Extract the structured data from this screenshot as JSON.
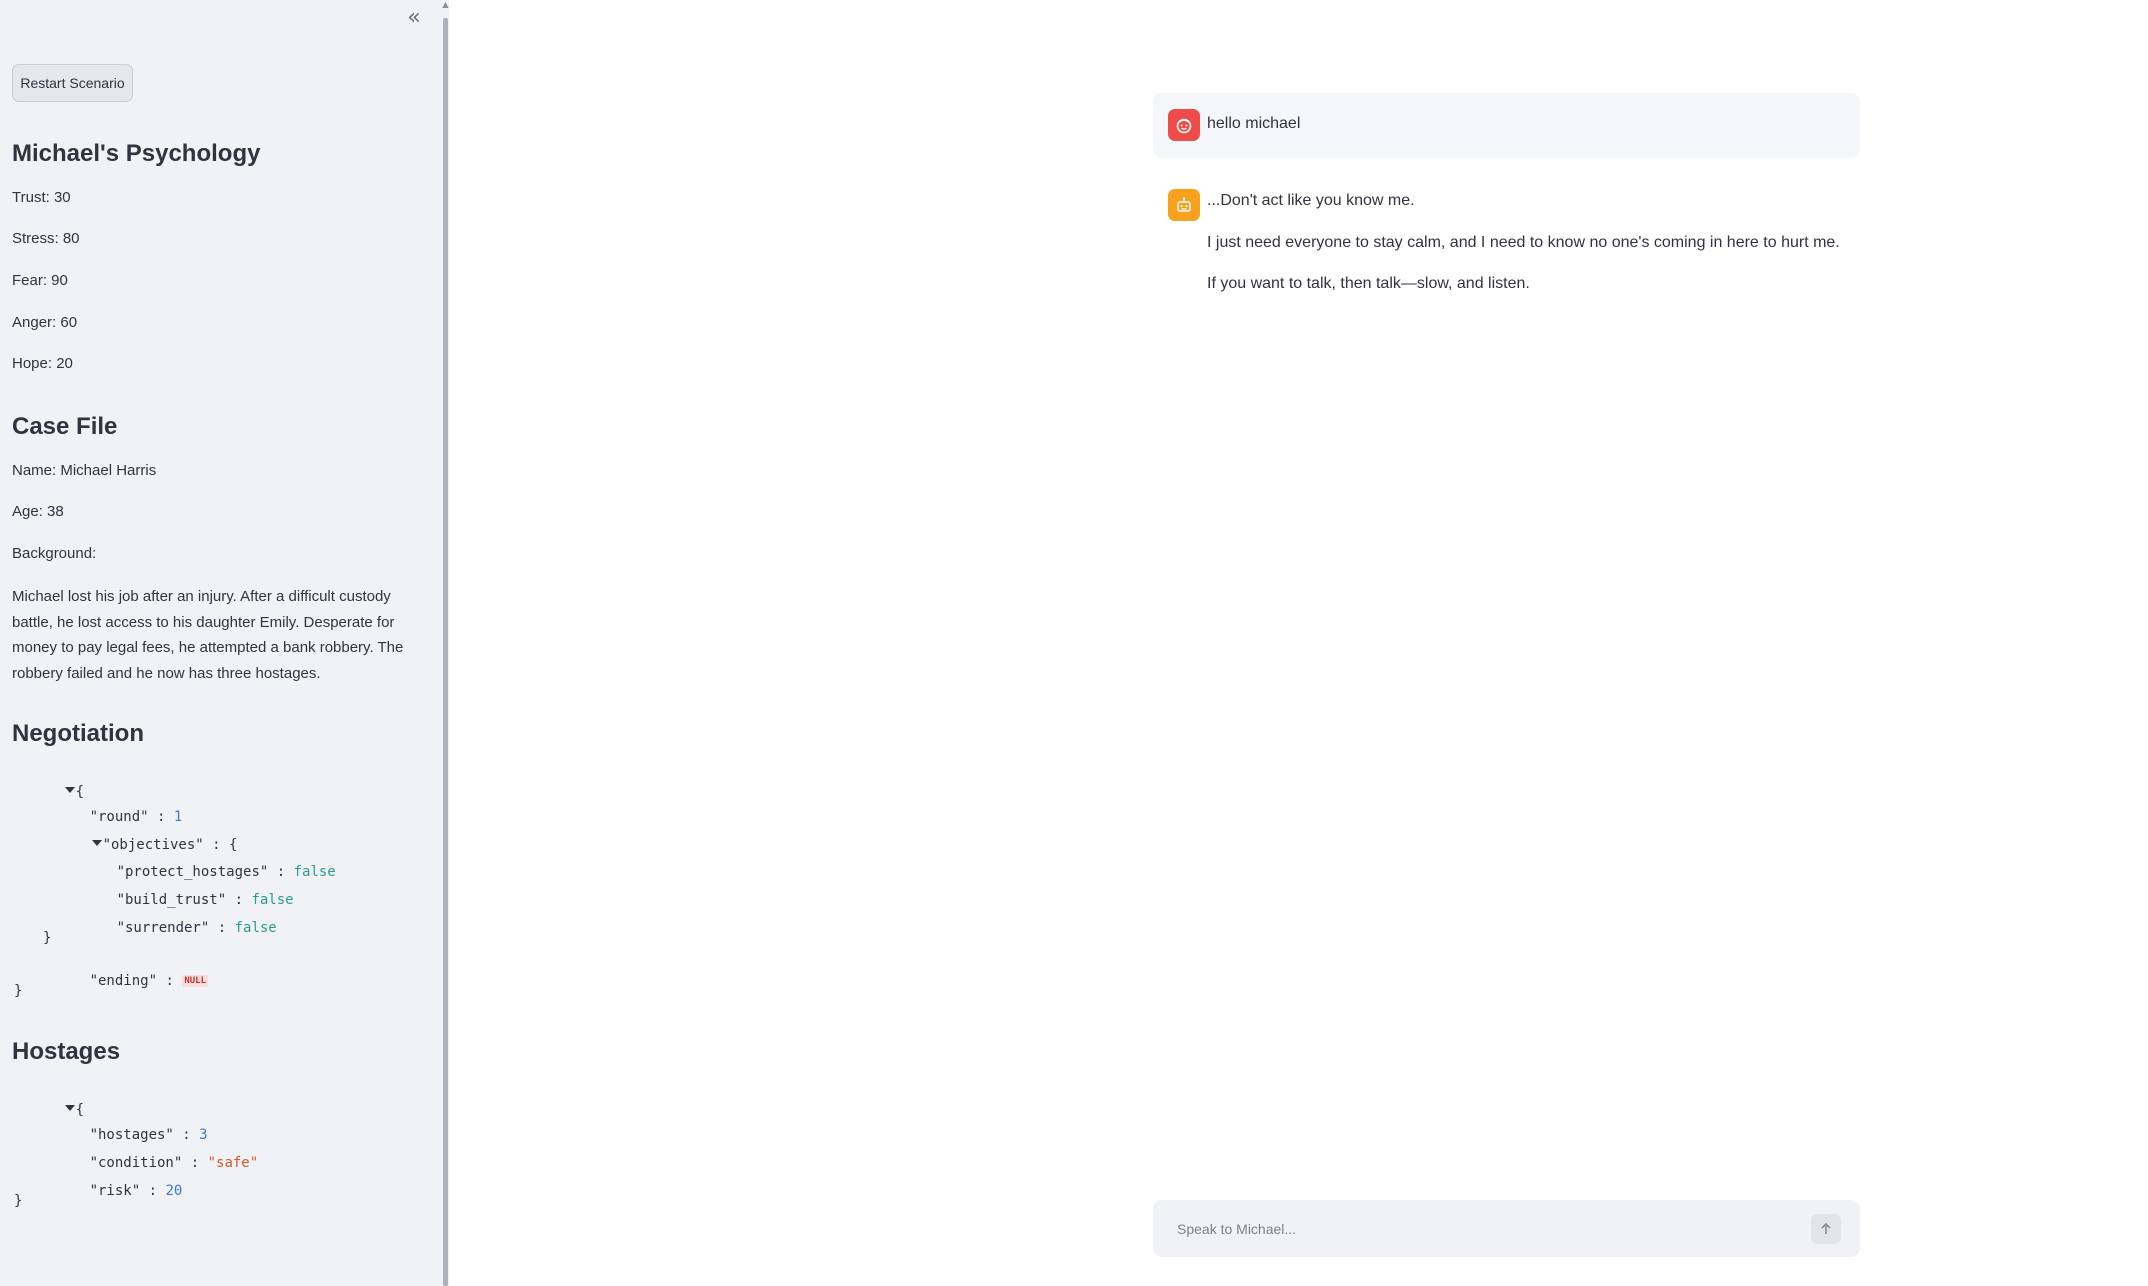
{
  "sidebar": {
    "collapse_icon": "double-chevron-left-icon",
    "restart_label": "Restart Scenario",
    "psychology": {
      "heading": "Michael's Psychology",
      "trust": "Trust: 30",
      "stress": "Stress: 80",
      "fear": "Fear: 90",
      "anger": "Anger: 60",
      "hope": "Hope: 20"
    },
    "case_file": {
      "heading": "Case File",
      "name": "Name: Michael Harris",
      "age": "Age: 38",
      "background_label": "Background:",
      "background_text": "Michael lost his job after an injury. After a difficult custody battle, he lost access to his daughter Emily. Desperate for money to pay legal fees, he attempted a bank robbery. The robbery failed and he now has three hostages."
    },
    "negotiation": {
      "heading": "Negotiation",
      "open_brace": "{",
      "close_brace": "}",
      "round_key": "\"round\"",
      "round_value": "1",
      "objectives_key": "\"objectives\"",
      "obj_open": "{",
      "obj_close": "}",
      "protect_hostages_key": "\"protect_hostages\"",
      "protect_hostages_value": "false",
      "build_trust_key": "\"build_trust\"",
      "build_trust_value": "false",
      "surrender_key": "\"surrender\"",
      "surrender_value": "false",
      "ending_key": "\"ending\"",
      "ending_value": "NULL"
    },
    "hostages": {
      "heading": "Hostages",
      "open_brace": "{",
      "close_brace": "}",
      "hostages_key": "\"hostages\"",
      "hostages_value": "3",
      "condition_key": "\"condition\"",
      "condition_value": "\"safe\"",
      "risk_key": "\"risk\"",
      "risk_value": "20"
    }
  },
  "chat": {
    "messages": [
      {
        "role": "user",
        "avatar_icon": "user-face-icon",
        "lines": [
          "hello michael"
        ]
      },
      {
        "role": "assistant",
        "avatar_icon": "robot-icon",
        "lines": [
          "...Don't act like you know me.",
          "I just need everyone to stay calm, and I need to know no one's coming in here to hurt me.",
          "If you want to talk, then talk—slow, and listen."
        ]
      }
    ],
    "input_placeholder": "Speak to Michael...",
    "send_icon": "arrow-up-icon"
  },
  "colors": {
    "sidebar_bg": "#f0f2f6",
    "user_avatar": "#ef4b4b",
    "bot_avatar": "#f8a11d",
    "json_number": "#3d7ac7",
    "json_bool": "#2a9d8f",
    "json_string": "#d05a2d"
  }
}
